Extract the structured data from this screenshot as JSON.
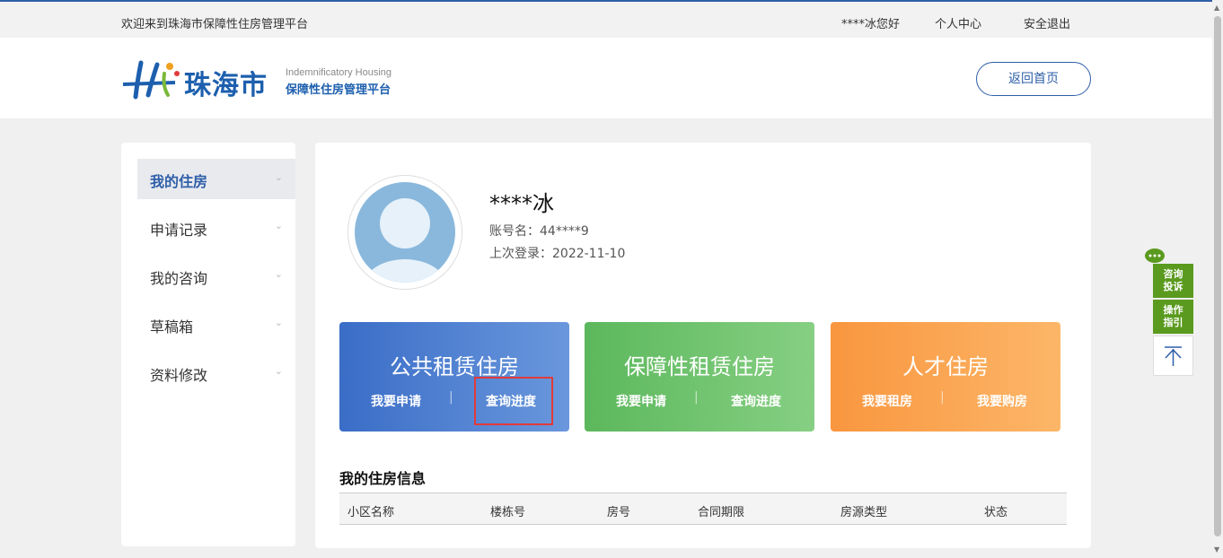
{
  "topbar": {
    "welcome": "欢迎来到珠海市保障性住房管理平台",
    "user_greeting": "****冰您好",
    "personal_center": "个人中心",
    "logout": "安全退出"
  },
  "header": {
    "logo_city": "珠海市",
    "logo_en": "Indemnificatory Housing",
    "logo_cn": "保障性住房管理平台",
    "home_button": "返回首页"
  },
  "sidebar": {
    "items": [
      {
        "label": "我的住房",
        "active": true
      },
      {
        "label": "申请记录"
      },
      {
        "label": "我的咨询"
      },
      {
        "label": "草稿箱"
      },
      {
        "label": "资料修改"
      }
    ]
  },
  "profile": {
    "name": "****冰",
    "account": "账号名：44****9",
    "last_login": "上次登录：2022-11-10"
  },
  "cards": [
    {
      "title": "公共租赁住房",
      "action1": "我要申请",
      "sep": "|",
      "action2": "查询进度"
    },
    {
      "title": "保障性租赁住房",
      "action1": "我要申请",
      "sep": "|",
      "action2": "查询进度"
    },
    {
      "title": "人才住房",
      "action1": "我要租房",
      "sep": "|",
      "action2": "我要购房"
    }
  ],
  "housing_info": {
    "title": "我的住房信息",
    "columns": [
      "小区名称",
      "楼栋号",
      "房号",
      "合同期限",
      "房源类型",
      "状态"
    ]
  },
  "float_tools": {
    "consult": "咨询投诉",
    "guide": "操作指引",
    "top_icon": "arrow-to-top-icon"
  },
  "colors": {
    "brand_blue": "#2e5fa8",
    "card1": "#3a6dc7",
    "card2": "#5cb85c",
    "card3": "#f9963f",
    "highlight": "#e23a3a",
    "float_green": "#5a9a1e"
  }
}
